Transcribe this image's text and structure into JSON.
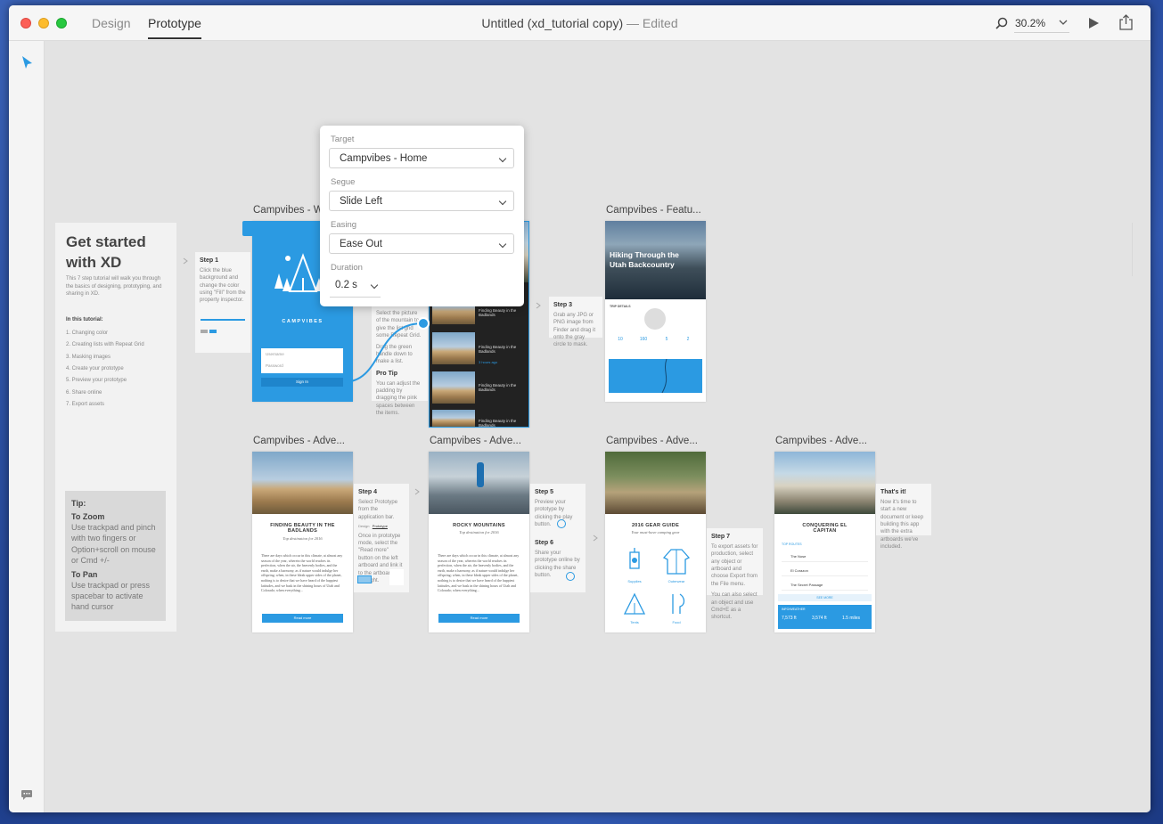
{
  "window": {
    "tabs": [
      "Design",
      "Prototype"
    ],
    "active_tab": "Prototype",
    "title": "Untitled (xd_tutorial copy)",
    "edited": "— Edited",
    "zoom": "30.2%"
  },
  "sidebar_panel": {
    "title_line1": "Get started",
    "title_line2": "with XD",
    "intro": "This 7 step tutorial will walk you through the basics of designing, prototyping, and sharing in XD.",
    "list_heading": "In this tutorial:",
    "steps": [
      "1. Changing color",
      "2. Creating lists with Repeat Grid",
      "3. Masking images",
      "4. Create your prototype",
      "5. Preview your prototype",
      "6. Share online",
      "7. Export assets"
    ],
    "tip": {
      "heading": "Tip:",
      "zoom_title": "To Zoom",
      "zoom_text": "Use trackpad and pinch with two fingers or Option+scroll on mouse or Cmd +/-",
      "pan_title": "To Pan",
      "pan_text": "Use trackpad or press spacebar to activate hand cursor"
    }
  },
  "popover": {
    "target_label": "Target",
    "target_value": "Campvibes - Home",
    "segue_label": "Segue",
    "segue_value": "Slide Left",
    "easing_label": "Easing",
    "easing_value": "Ease Out",
    "duration_label": "Duration",
    "duration_value": "0.2 s"
  },
  "artboards": {
    "welcome": {
      "title": "Campvibes - W",
      "brand": "CAMPVIBES",
      "username": "Username",
      "password": "Password",
      "signin": "Sign In"
    },
    "feature": {
      "title": "Campvibes - Featu...",
      "headline": "Hiking Through the Utah Backcountry",
      "trip": "TRIP DETAILS",
      "stats": [
        "10",
        "160",
        "5",
        "2"
      ]
    },
    "adv1": {
      "title": "Campvibes - Adve...",
      "headline": "FINDING BEAUTY IN THE BADLANDS",
      "sub": "Top destination for 2016",
      "body": "There are days which occur in this climate, at almost any season of the year, wherein the world reaches its perfection, when the air, the heavenly bodies, and the earth, make a harmony, as if nature would indulge her offspring; when, in these bleak upper sides of the planet, nothing is to desire that we have heard of the happiest latitudes, and we bask in the shining hours of Utah and Colorado; when everything...",
      "button": "Read more"
    },
    "adv2": {
      "title": "Campvibes - Adve...",
      "headline": "ROCKY MOUNTAINS",
      "sub": "Top destination for 2016",
      "body": "There are days which occur in this climate, at almost any season of the year, wherein the world reaches its perfection, when the air, the heavenly bodies, and the earth, make a harmony, as if nature would indulge her offspring; when, in these bleak upper sides of the planet, nothing is to desire that we have heard of the happiest latitudes, and we bask in the shining hours of Utah and Colorado; when everything...",
      "button": "Read more"
    },
    "adv3": {
      "title": "Campvibes - Adve...",
      "headline": "2016 GEAR GUIDE",
      "sub": "Your must-have camping gear",
      "items": [
        "Supplies",
        "Outerwear",
        "Tents",
        "Food"
      ]
    },
    "adv4": {
      "title": "Campvibes - Adve...",
      "headline": "CONQUERING EL CAPITAN",
      "routes_label": "TOP ROUTES",
      "routes": [
        "The Nose",
        "El Corazon",
        "The Secret Passage"
      ],
      "more": "SEE MORE",
      "info": "INFO/WEATHER",
      "stats": [
        "7,573 ft",
        "3,574 ft",
        "1.5 miles"
      ]
    },
    "list": {
      "items": [
        "Finding Beauty in the Badlands",
        "Finding Beauty in the Badlands",
        "Finding Beauty in the Badlands",
        "Finding Beauty in the Badlands"
      ],
      "meta": "3 hours ago"
    }
  },
  "steps": {
    "step1": {
      "title": "Step 1",
      "text": "Click the blue background and change the color using \"Fill\" from the property inspector."
    },
    "step2": {
      "text": "Select the picture of the mountain to give the list grid some Repeat Grid.",
      "text2": "Drag the green handle down to make a list.",
      "tip_title": "Pro Tip",
      "tip": "You can adjust the padding by dragging the pink spaces between the items."
    },
    "step3": {
      "title": "Step 3",
      "text": "Grab any JPG or PNG image from Finder and drag it onto the gray circle to mask."
    },
    "step4": {
      "title": "Step 4",
      "text": "Select Prototype from the application bar.",
      "text2": "Once in prototype mode, select the \"Read more\" button on the left artboard and link it to the artboard to the right.",
      "tabs": [
        "Design",
        "Prototype"
      ]
    },
    "step5": {
      "title": "Step 5",
      "text": "Preview your prototype by clicking the play button."
    },
    "step6": {
      "title": "Step 6",
      "text": "Share your prototype online by clicking the share button."
    },
    "step7": {
      "title": "Step 7",
      "text": "To export assets for production, select any object or artboard and choose Export from the File menu.",
      "text2": "You can also select an object and use Cmd+E as a shortcut."
    },
    "done": {
      "title": "That's it!",
      "text": "Now it's time to start a new document or keep building this app with the extra artboards we've included."
    }
  },
  "colors": {
    "accent": "#2b9ae2",
    "close": "#fc5f57",
    "minimize": "#fdbc2e",
    "zoom": "#28c840"
  }
}
